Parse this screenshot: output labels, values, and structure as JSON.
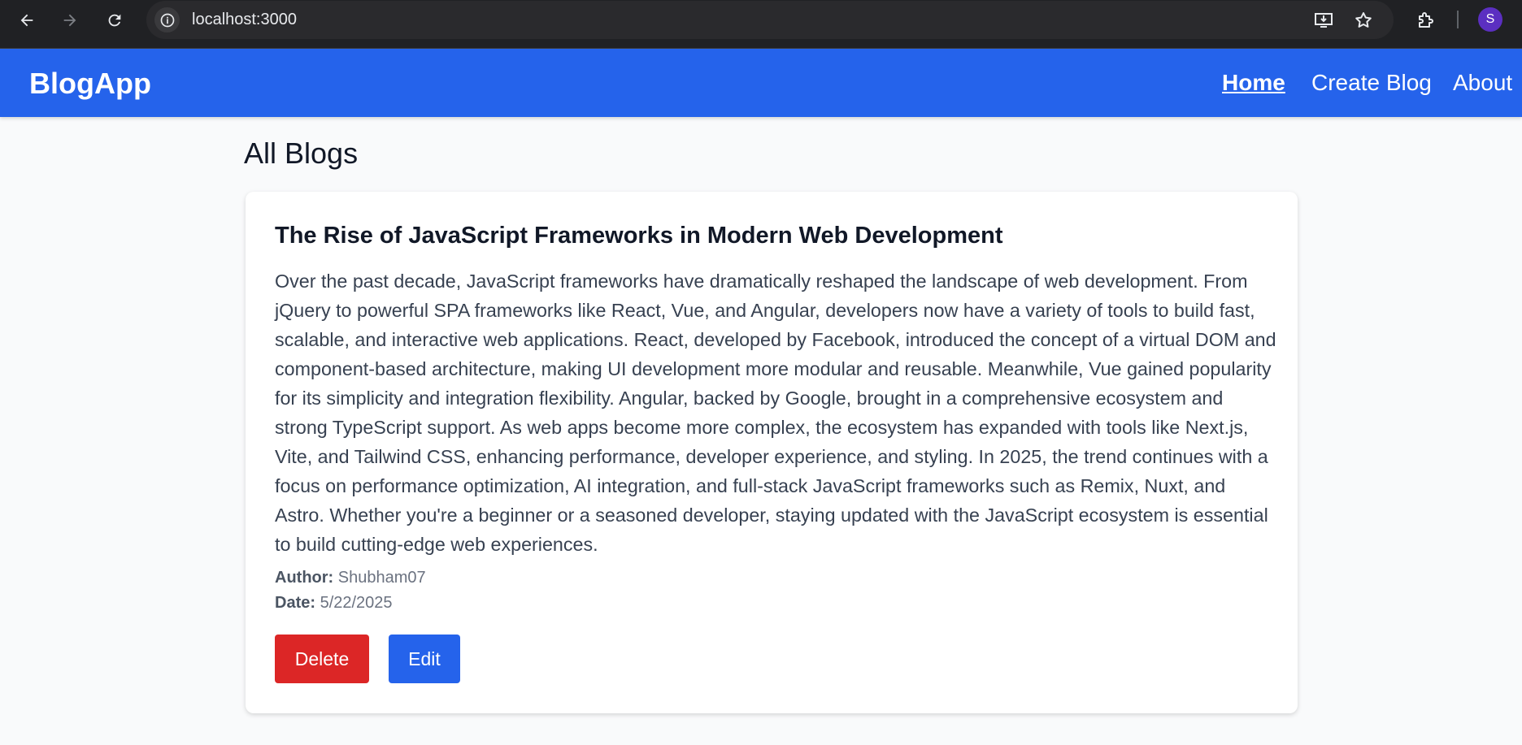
{
  "browser": {
    "url": "localhost:3000",
    "profile_initial": "S"
  },
  "header": {
    "brand": "BlogApp",
    "nav": [
      {
        "label": "Home",
        "active": true
      },
      {
        "label": "Create Blog",
        "active": false
      },
      {
        "label": "About",
        "active": false
      }
    ]
  },
  "main": {
    "title": "All Blogs",
    "blogs": [
      {
        "title": "The Rise of JavaScript Frameworks in Modern Web Development",
        "content": "Over the past decade, JavaScript frameworks have dramatically reshaped the landscape of web development. From jQuery to powerful SPA frameworks like React, Vue, and Angular, developers now have a variety of tools to build fast, scalable, and interactive web applications. React, developed by Facebook, introduced the concept of a virtual DOM and component-based architecture, making UI development more modular and reusable. Meanwhile, Vue gained popularity for its simplicity and integration flexibility. Angular, backed by Google, brought in a comprehensive ecosystem and strong TypeScript support. As web apps become more complex, the ecosystem has expanded with tools like Next.js, Vite, and Tailwind CSS, enhancing performance, developer experience, and styling. In 2025, the trend continues with a focus on performance optimization, AI integration, and full-stack JavaScript frameworks such as Remix, Nuxt, and Astro. Whether you're a beginner or a seasoned developer, staying updated with the JavaScript ecosystem is essential to build cutting-edge web experiences.",
        "author_label": "Author:",
        "author": "Shubham07",
        "date_label": "Date:",
        "date": "5/22/2025",
        "delete_label": "Delete",
        "edit_label": "Edit"
      }
    ]
  },
  "colors": {
    "header": "#2563eb",
    "delete": "#dc2626",
    "edit": "#2563eb",
    "background": "#f9fafb"
  }
}
